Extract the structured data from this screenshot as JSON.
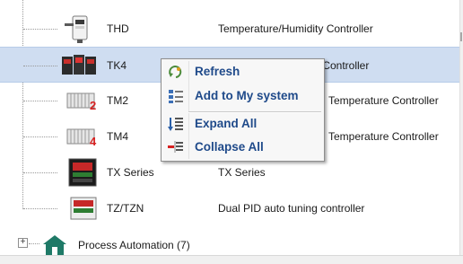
{
  "tree": {
    "rows": [
      {
        "name": "THD",
        "description": "Temperature/Humidity Controller",
        "icon": "thd-device-icon"
      },
      {
        "name": "TK4",
        "description": "s Controller",
        "icon": "tk4-device-icon",
        "selected": true
      },
      {
        "name": "TM2",
        "description": "Temperature Controller",
        "icon": "tm2-device-icon",
        "badge": "2"
      },
      {
        "name": "TM4",
        "description": "Temperature Controller",
        "icon": "tm4-device-icon",
        "badge": "4"
      },
      {
        "name": "TX Series",
        "description": "TX Series",
        "icon": "tx-series-device-icon"
      },
      {
        "name": "TZ/TZN",
        "description": "Dual PID auto tuning controller",
        "icon": "tz-tzn-device-icon"
      }
    ],
    "group": {
      "label": "Process Automation (7)",
      "expander": "+",
      "icon": "house-group-icon"
    }
  },
  "context_menu": {
    "items": [
      {
        "label": "Refresh",
        "icon": "refresh-icon"
      },
      {
        "label": "Add to My system",
        "icon": "add-to-system-icon"
      },
      {
        "label": "Expand All",
        "icon": "expand-all-icon"
      },
      {
        "label": "Collapse All",
        "icon": "collapse-all-icon"
      }
    ]
  },
  "colors": {
    "selection": "#cfddf1",
    "menu_text": "#1f4a8a",
    "badge_red": "#d62020",
    "group_icon": "#1f7a67"
  }
}
